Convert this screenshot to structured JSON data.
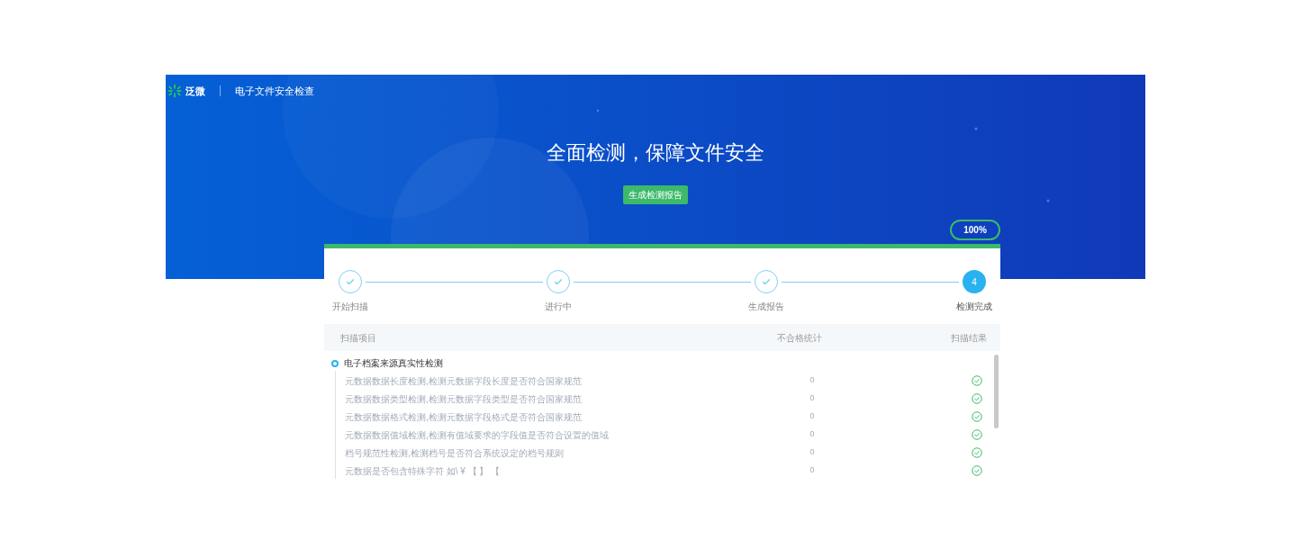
{
  "header": {
    "logo_text": "泛微",
    "title": "电子文件安全检查"
  },
  "hero": {
    "headline": "全面检测，保障文件安全",
    "button": "生成检测报告",
    "progress": "100%",
    "level": 1
  },
  "steps": [
    {
      "label": "开始扫描",
      "done": true
    },
    {
      "label": "进行中",
      "done": true
    },
    {
      "label": "生成报告",
      "done": true
    },
    {
      "label": "检测完成",
      "done": false,
      "number": "4"
    }
  ],
  "table": {
    "columns": [
      "扫描项目",
      "不合格统计",
      "扫描结果"
    ],
    "group": "电子档案来源真实性检测",
    "rows": [
      {
        "item": "元数据数据长度检测,检测元数据字段长度是否符合国家规范",
        "count": "0",
        "passed": true
      },
      {
        "item": "元数据数据类型检测,检测元数据字段类型是否符合国家规范",
        "count": "0",
        "passed": true
      },
      {
        "item": "元数据数据格式检测,检测元数据字段格式是否符合国家规范",
        "count": "0",
        "passed": true
      },
      {
        "item": "元数据数据值域检测,检测有值域要求的字段值是否符合设置的值域",
        "count": "0",
        "passed": true
      },
      {
        "item": "档号规范性检测,检测档号是否符合系统设定的档号规则",
        "count": "0",
        "passed": true
      },
      {
        "item": "元数据是否包含特殊字符 如\\ ¥ 【 】 【",
        "count": "0",
        "passed": true
      }
    ]
  }
}
